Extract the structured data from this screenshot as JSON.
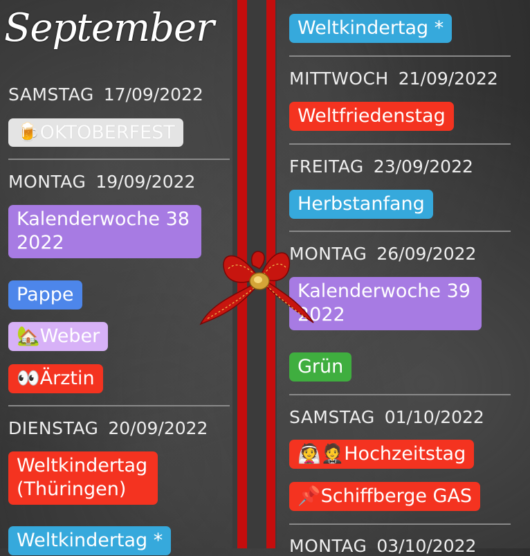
{
  "header": {
    "month_title": "September"
  },
  "left": {
    "sections": [
      {
        "day": "SAMSTAG",
        "date": "17/09/2022",
        "events": [
          {
            "icon": "beer-mug-icon",
            "label": "OKTOBERFEST",
            "color": "#e4e4e4"
          }
        ]
      },
      {
        "day": "MONTAG",
        "date": "19/09/2022",
        "events": [
          {
            "label": "Kalenderwoche 38 2022",
            "color": "#a77be3"
          },
          {
            "label": "Pappe",
            "color": "#4d86ea"
          },
          {
            "icon": "house-with-tree-icon",
            "label": "Weber",
            "color": "#d7b1f7"
          },
          {
            "icon": "eyes-icon",
            "label": "Ärztin",
            "color": "#f43320"
          }
        ]
      },
      {
        "day": "DIENSTAG",
        "date": "20/09/2022",
        "events": [
          {
            "label": "Weltkindertag (Thüringen)",
            "color": "#f43320"
          },
          {
            "label": "Weltkindertag *",
            "color": "#36a9dc"
          }
        ]
      }
    ]
  },
  "right": {
    "top_event": {
      "label": "Weltkindertag *",
      "color": "#36a9dc"
    },
    "sections": [
      {
        "day": "MITTWOCH",
        "date": "21/09/2022",
        "events": [
          {
            "label": "Weltfriedenstag",
            "color": "#f43320"
          }
        ]
      },
      {
        "day": "FREITAG",
        "date": "23/09/2022",
        "events": [
          {
            "label": "Herbstanfang",
            "color": "#36a9dc"
          }
        ]
      },
      {
        "day": "MONTAG",
        "date": "26/09/2022",
        "events": [
          {
            "label": "Kalenderwoche 39 2022",
            "color": "#a77be3"
          },
          {
            "label": "Grün",
            "color": "#3fae3f"
          }
        ]
      },
      {
        "day": "SAMSTAG",
        "date": "01/10/2022",
        "events": [
          {
            "icon": "bride-groom-icon",
            "label": "Hochzeitstag",
            "color": "#f43320"
          },
          {
            "icon": "pushpin-icon",
            "label": "Schiffberge GAS",
            "color": "#f43320"
          }
        ]
      },
      {
        "day": "MONTAG",
        "date": "03/10/2022",
        "events": []
      }
    ]
  },
  "decoration": {
    "ribbon_color": "#c40d0d",
    "bow_icon": "gift-bow-icon"
  }
}
